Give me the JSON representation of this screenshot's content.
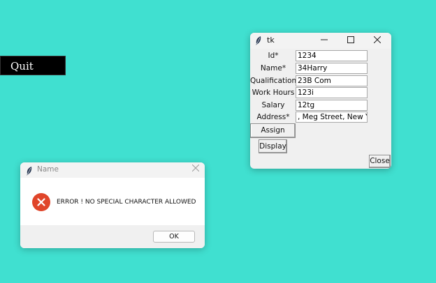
{
  "desktop": {
    "quit_label": "Quit"
  },
  "tk_window": {
    "title": "tk",
    "fields": [
      {
        "label": "Id*",
        "value": "1234"
      },
      {
        "label": "Name*",
        "value": "34Harry"
      },
      {
        "label": "Qualifications",
        "value": "23B Com"
      },
      {
        "label": "Work Hours",
        "value": "123i"
      },
      {
        "label": "Salary",
        "value": "12tg"
      },
      {
        "label": "Address*",
        "value": ", Meg Street, New York"
      }
    ],
    "assign_label": "Assign Value",
    "display_label": "Display",
    "close_label": "Close"
  },
  "dialog": {
    "title": "Name",
    "message": "ERROR ! NO SPECIAL CHARACTER ALLOWED",
    "ok_label": "OK"
  },
  "icons": {
    "app": "feather-icon",
    "error": "error-icon",
    "error_color": "#e0452a",
    "desktop_background": "#40e0d0"
  }
}
